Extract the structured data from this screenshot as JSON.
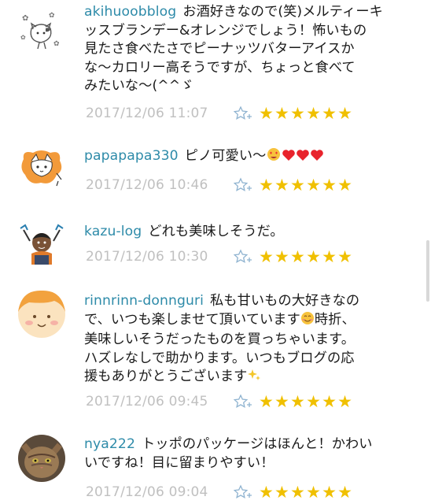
{
  "comments": [
    {
      "user": "akihuoobblog",
      "lines": [
        "お酒好きなので(笑)メルティーキ",
        "ッスブランデー&オレンジでしょう！怖いもの",
        "見たさ食べたさでピーナッツバターアイスか",
        "な～カロリー高そうですが、ちょっと食べて",
        "みたいな～(^^ゞ"
      ],
      "timestamp": "2017/12/06 11:07",
      "stars": "★★★★★★"
    },
    {
      "user": "papapapa330",
      "lines": [
        "ピノ可愛い～"
      ],
      "timestamp": "2017/12/06 10:46",
      "stars": "★★★★★★"
    },
    {
      "user": "kazu-log",
      "lines": [
        "どれも美味しそうだ。"
      ],
      "timestamp": "2017/12/06 10:30",
      "stars": "★★★★★★"
    },
    {
      "user": "rinnrinn-donnguri",
      "lines": [
        "私も甘いもの大好きなの",
        "で、いつも楽しませて頂いています",
        "時折、",
        "美味しいそうだったものを買っちゃいます。",
        "ハズレなしで助かります。いつもブログの応",
        "援もありがとうございます"
      ],
      "timestamp": "2017/12/06 09:45",
      "stars": "★★★★★★"
    },
    {
      "user": "nya222",
      "lines": [
        "トッポのパッケージはほんと！かわい",
        "いですね！目に留まりやすい！"
      ],
      "timestamp": "2017/12/06 09:04",
      "stars": "★★★★★★"
    }
  ],
  "colors": {
    "username": "#2e8ba9",
    "timestamp": "#c0c0c0",
    "star": "#f0c000",
    "fav_icon": "#8fb3d0"
  },
  "icons": [
    "cat-avatar-icon",
    "fox-avatar-icon",
    "person-avatar-icon",
    "smiley-avatar-icon",
    "cat-photo-avatar-icon",
    "add-star-icon",
    "star-icon",
    "heart-eyes-emoji-icon",
    "heart-icon",
    "smile-emoji-icon",
    "sparkles-emoji-icon"
  ]
}
